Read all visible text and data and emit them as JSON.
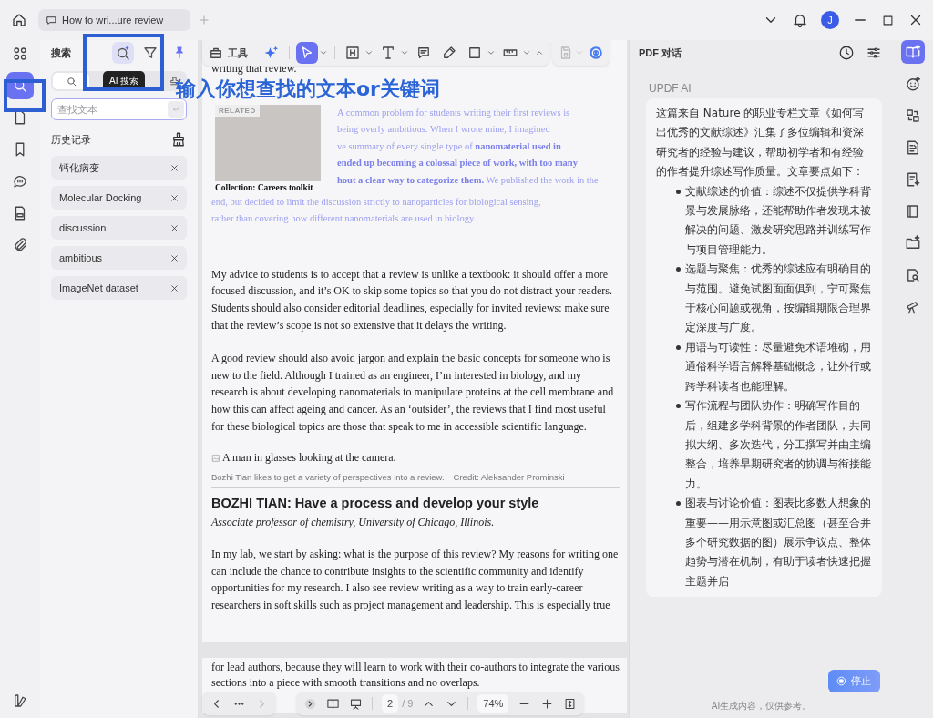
{
  "title_bar": {
    "tab": "How to wri...ure review",
    "avatar": "J"
  },
  "left_rail": {
    "items": [
      {
        "kind": "apps",
        "selected": false
      },
      {
        "kind": "search",
        "selected": true
      },
      {
        "kind": "pages",
        "selected": false
      },
      {
        "kind": "bookmarks",
        "selected": false
      },
      {
        "kind": "comments",
        "selected": false
      },
      {
        "kind": "forms",
        "selected": false
      },
      {
        "kind": "attachments",
        "selected": false
      }
    ]
  },
  "search_panel": {
    "title": "搜索",
    "modes": [
      {
        "kind": "ai-search",
        "selected": true
      },
      {
        "kind": "filter",
        "selected": false
      }
    ],
    "pinned": true,
    "tooltip": "AI 搜索",
    "options": [
      {
        "kind": "text",
        "selected": true
      },
      {
        "kind": "stamp",
        "selected": false
      }
    ],
    "field": {
      "placeholder": "查找文本"
    },
    "history_title": "历史记录",
    "history": [
      "钙化病变",
      "Molecular Docking",
      "discussion",
      "ambitious",
      "ImageNet dataset"
    ]
  },
  "annotation": {
    "text": "输入你想查找的文本or关键词"
  },
  "toolbar": {
    "tools_label": "工具",
    "items": [
      {
        "kind": "ai",
        "selected": false
      },
      {
        "kind": "select",
        "selected": true
      },
      {
        "kind": "heading",
        "selected": false
      },
      {
        "kind": "text",
        "selected": false
      },
      {
        "kind": "comment",
        "selected": false
      },
      {
        "kind": "pen",
        "selected": false
      },
      {
        "kind": "shape",
        "selected": false
      },
      {
        "kind": "measure",
        "selected": false
      }
    ],
    "extras": [
      {
        "kind": "save",
        "disabled": true
      },
      {
        "kind": "assistant",
        "disabled": false
      }
    ]
  },
  "document": {
    "page_1": [
      {
        "kind": "text",
        "text": "writing that review."
      },
      {
        "kind": "related",
        "label": "RELATED",
        "caption": "Collection: Careers toolkit",
        "lines": [
          "A common problem for students writing their first reviews is",
          "being overly ambitious. When I wrote mine, I imagined",
          "ve summary of every single type of **nanomaterial used in**",
          "**ended up becoming a colossal piece of work, with too many**",
          "**hout a clear way to categorize them.** We published the work in the",
          "end, but decided to limit the discussion strictly to nanoparticles for biological sensing,",
          "rather than covering how different nanomaterials are used in biology."
        ]
      },
      {
        "kind": "paragraph",
        "text": "My advice to students is to accept that a review is unlike a textbook: it should offer a more focused discussion, and it’s OK to skip some topics so that you do not distract your readers. Students should also consider editorial deadlines, especially for invited reviews: make sure that the review’s scope is not so extensive that it delays the writing."
      },
      {
        "kind": "paragraph",
        "text": "A good review should also avoid jargon and explain the basic concepts for someone who is new to the field. Although I trained as an engineer, I’m interested in biology, and my research is about developing nanomaterials to manipulate proteins at the cell membrane and how this can affect ageing and cancer. As an ‘outsider’, the reviews that I find most useful for these biological topics are those that speak to me in accessible scientific language."
      },
      {
        "kind": "image",
        "text": "A man in glasses looking at the camera."
      },
      {
        "kind": "caption",
        "text": "Bozhi Tian likes to get a variety of perspectives into a review.",
        "credit": "Credit: Aleksander Prominski"
      },
      {
        "kind": "heading",
        "text": "BOZHI TIAN: Have a process and develop your style"
      },
      {
        "kind": "subtitle",
        "text": "Associate professor of chemistry, University of Chicago, Illinois."
      },
      {
        "kind": "paragraph",
        "text": "In my lab, we start by asking: what is the purpose of this review? My reasons for writing one can include the chance to contribute insights to the scientific community and identify opportunities for my research. I also see review writing as a way to train early-career researchers in soft skills such as project management and leadership. This is especially true"
      }
    ],
    "page_2": [
      {
        "kind": "paragraph",
        "text": "for lead authors, because they will learn to work with their co-authors to integrate the various sections into a piece with smooth transitions and no overlaps."
      }
    ]
  },
  "bottom_bar": {
    "page": "2",
    "page_total": "/ 9",
    "zoom": "74%",
    "next_disabled": true
  },
  "ai_panel": {
    "title": "PDF 对话",
    "assistant": "UPDF AI",
    "intro": "这篇来自 Nature 的职业专栏文章《如何写出优秀的文献综述》汇集了多位编辑和资深研究者的经验与建议，帮助初学者和有经验的作者提升综述写作质量。文章要点如下：",
    "bullets": [
      "文献综述的价值：综述不仅提供学科背景与发展脉络，还能帮助作者发现未被解决的问题、激发研究思路并训练写作与项目管理能力。",
      "选题与聚焦：优秀的综述应有明确目的与范围。避免试图面面俱到，宁可聚焦于核心问题或视角，按编辑期限合理界定深度与广度。",
      "用语与可读性：尽量避免术语堆砌，用通俗科学语言解释基础概念，让外行或跨学科读者也能理解。",
      "写作流程与团队协作：明确写作目的后，组建多学科背景的作者团队，共同拟大纲、多次迭代，分工撰写并由主编整合，培养早期研究者的协调与衔接能力。",
      "图表与讨论价值：图表比多数人想象的重要——用示意图或汇总图（甚至合并多个研究数据的图）展示争议点、整体趋势与潜在机制，有助于读者快速把握主题并启"
    ],
    "stop": "停止",
    "footer": "AI生成内容，仅供参考。"
  },
  "right_rail": {
    "items": [
      {
        "kind": "chat",
        "selected": true
      },
      {
        "kind": "emoji",
        "selected": false
      },
      {
        "kind": "translate",
        "selected": false
      },
      {
        "kind": "translate-doc",
        "selected": false
      },
      {
        "kind": "summary",
        "selected": false
      },
      {
        "kind": "book",
        "selected": false
      },
      {
        "kind": "folder",
        "selected": false
      },
      {
        "kind": "search",
        "selected": false
      },
      {
        "kind": "telescope",
        "selected": false
      }
    ]
  }
}
